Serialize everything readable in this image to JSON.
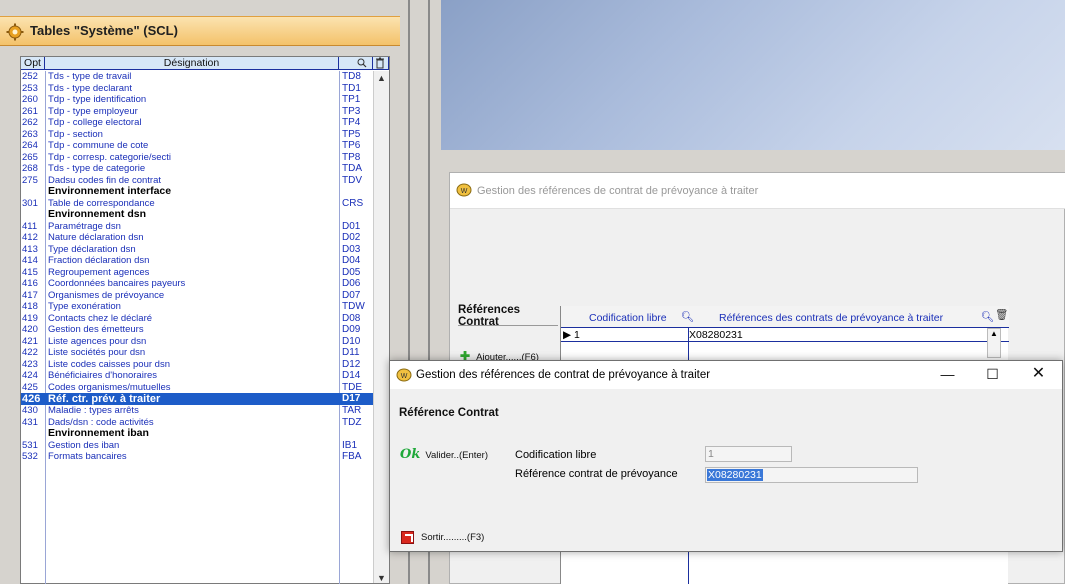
{
  "left_panel": {
    "title": "Tables \"Système\" (SCL)",
    "columns": {
      "opt": "Opt",
      "designation": "Désignation"
    },
    "rows": [
      {
        "opt": "252",
        "des": "Tds - type de travail",
        "code": "TD8"
      },
      {
        "opt": "253",
        "des": "Tds - type declarant",
        "code": "TD1"
      },
      {
        "opt": "260",
        "des": "Tdp - type identification",
        "code": "TP1"
      },
      {
        "opt": "261",
        "des": "Tdp - type employeur",
        "code": "TP3"
      },
      {
        "opt": "262",
        "des": "Tdp - college electoral",
        "code": "TP4"
      },
      {
        "opt": "263",
        "des": "Tdp - section",
        "code": "TP5"
      },
      {
        "opt": "264",
        "des": "Tdp - commune de cote",
        "code": "TP6"
      },
      {
        "opt": "265",
        "des": "Tdp - corresp. categorie/secti",
        "code": "TP8"
      },
      {
        "opt": "268",
        "des": "Tds - type de categorie",
        "code": "TDA"
      },
      {
        "opt": "275",
        "des": "Dadsu codes fin de contrat",
        "code": "TDV"
      },
      {
        "opt": "",
        "des": "Environnement interface",
        "code": "",
        "header": true
      },
      {
        "opt": "301",
        "des": "Table de correspondance",
        "code": "CRS"
      },
      {
        "opt": "",
        "des": "Environnement dsn",
        "code": "",
        "header": true
      },
      {
        "opt": "411",
        "des": "Paramétrage dsn",
        "code": "D01"
      },
      {
        "opt": "412",
        "des": "Nature déclaration dsn",
        "code": "D02"
      },
      {
        "opt": "413",
        "des": "Type déclaration dsn",
        "code": "D03"
      },
      {
        "opt": "414",
        "des": "Fraction déclaration dsn",
        "code": "D04"
      },
      {
        "opt": "415",
        "des": "Regroupement agences",
        "code": "D05"
      },
      {
        "opt": "416",
        "des": "Coordonnées bancaires payeurs",
        "code": "D06"
      },
      {
        "opt": "417",
        "des": "Organismes de prévoyance",
        "code": "D07"
      },
      {
        "opt": "418",
        "des": "Type exonération",
        "code": "TDW"
      },
      {
        "opt": "419",
        "des": "Contacts chez le déclaré",
        "code": "D08"
      },
      {
        "opt": "420",
        "des": "Gestion des émetteurs",
        "code": "D09"
      },
      {
        "opt": "421",
        "des": "Liste agences pour dsn",
        "code": "D10"
      },
      {
        "opt": "422",
        "des": "Liste sociétés pour dsn",
        "code": "D11"
      },
      {
        "opt": "423",
        "des": "Liste codes caisses pour dsn",
        "code": "D12"
      },
      {
        "opt": "424",
        "des": "Bénéficiaires d'honoraires",
        "code": "D14"
      },
      {
        "opt": "425",
        "des": "Codes organismes/mutuelles",
        "code": "TDE"
      },
      {
        "opt": "426",
        "des": "Réf. ctr. prév. à traiter",
        "code": "D17",
        "selected": true
      },
      {
        "opt": "430",
        "des": "Maladie : types arrêts",
        "code": "TAR"
      },
      {
        "opt": "431",
        "des": "Dads/dsn : code activités",
        "code": "TDZ"
      },
      {
        "opt": "",
        "des": "Environnement iban",
        "code": "",
        "header": true
      },
      {
        "opt": "531",
        "des": "Gestion des iban",
        "code": "IB1"
      },
      {
        "opt": "532",
        "des": "Formats bancaires",
        "code": "FBA"
      }
    ]
  },
  "background_window": {
    "title": "Gestion des références de contrat de prévoyance à traiter",
    "section_label": "Références Contrat",
    "col_code": "Codification libre",
    "col_ref": "Références des contrats de prévoyance à traiter",
    "row1_code": "1",
    "row1_ref": "X08280231",
    "add_label": "Ajouter......(F6)"
  },
  "dialog": {
    "title": "Gestion des références de contrat de prévoyance à traiter",
    "section_label": "Référence Contrat",
    "ok_glyph": "Ok",
    "ok_label": "Valider..(Enter)",
    "label_code": "Codification libre",
    "label_ref": "Référence contrat de prévoyance",
    "value_code": "1",
    "value_ref": "X08280231",
    "exit_label": "Sortir.........(F3)"
  },
  "colors": {
    "accent": "#1d5cc8",
    "row_text": "#1a2fb8",
    "title_gradient": "#f4c26a",
    "ok_green": "#1fa83a",
    "exit_red": "#d9281e"
  }
}
